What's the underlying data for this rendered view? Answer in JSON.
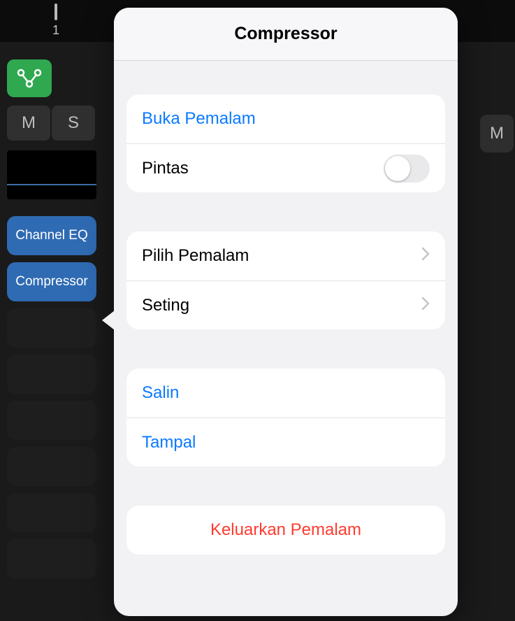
{
  "ruler": {
    "label": "1"
  },
  "channel": {
    "mute": "M",
    "solo": "S",
    "plugins": [
      {
        "name": "Channel EQ"
      },
      {
        "name": "Compressor"
      }
    ]
  },
  "right_mute": "M",
  "popover": {
    "title": "Compressor",
    "group1": {
      "open_plugin": "Buka Pemalam",
      "bypass_label": "Pintas",
      "bypass_on": false
    },
    "group2": {
      "choose_plugin": "Pilih Pemalam",
      "settings": "Seting"
    },
    "group3": {
      "copy": "Salin",
      "paste": "Tampal"
    },
    "group4": {
      "remove": "Keluarkan Pemalam"
    }
  },
  "colors": {
    "accent_blue": "#0a7aff",
    "danger_red": "#ff3b30",
    "routing_green": "#2FA84F",
    "plugin_blue": "#2f6bb3"
  }
}
